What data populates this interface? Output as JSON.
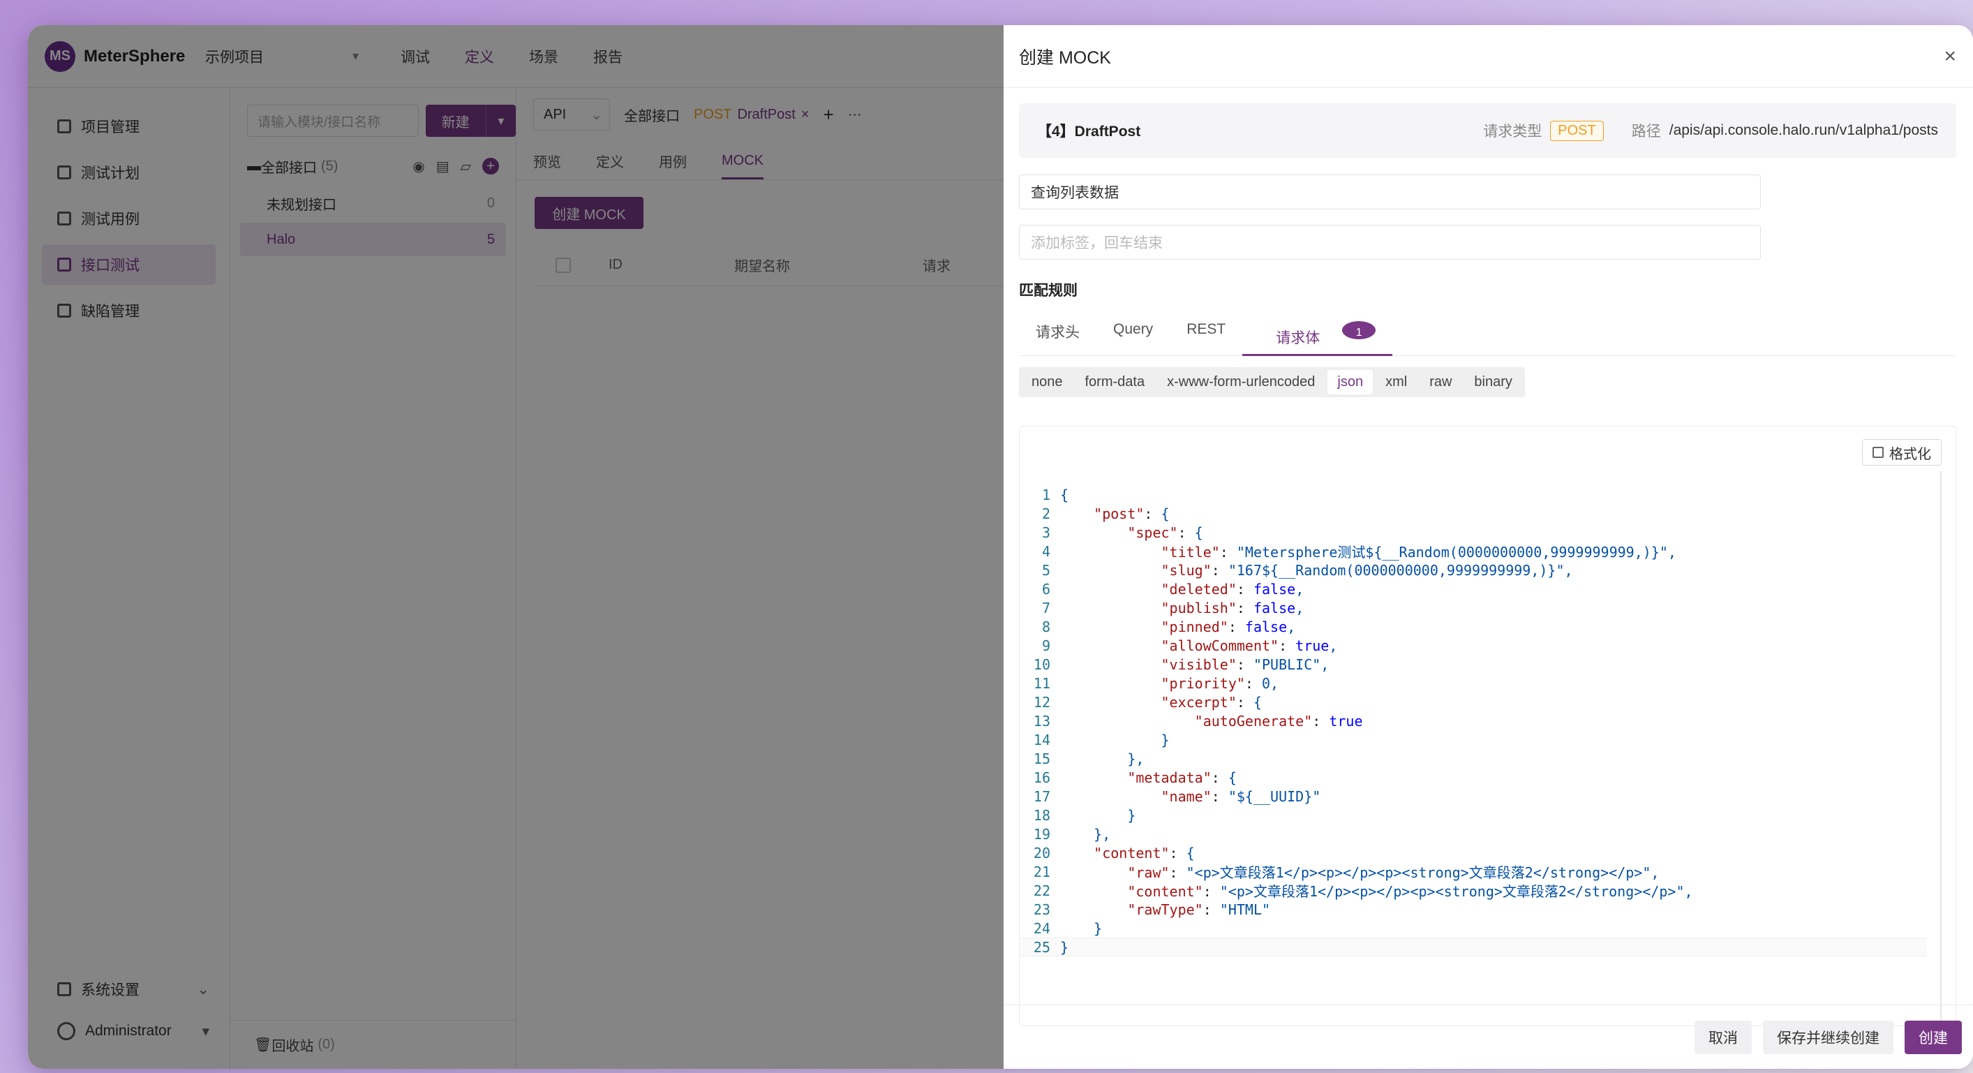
{
  "app": {
    "logo_text": "MeterSphere",
    "logo_glyph": "MS",
    "project": "示例项目",
    "top_nav": [
      "调试",
      "定义",
      "场景",
      "报告"
    ],
    "top_nav_active_index": 1
  },
  "sidebar": {
    "items": [
      {
        "label": "项目管理",
        "icon": "folder-icon"
      },
      {
        "label": "测试计划",
        "icon": "plan-icon"
      },
      {
        "label": "测试用例",
        "icon": "case-icon"
      },
      {
        "label": "接口测试",
        "icon": "api-icon"
      },
      {
        "label": "缺陷管理",
        "icon": "bug-icon"
      }
    ],
    "active_index": 3,
    "settings_label": "系统设置",
    "user_label": "Administrator"
  },
  "tree": {
    "search_placeholder": "请输入模块/接口名称",
    "new_button": "新建",
    "all_label": "全部接口",
    "all_count": "(5)",
    "nodes": [
      {
        "label": "未规划接口",
        "count": "0"
      },
      {
        "label": "Halo",
        "count": "5"
      }
    ],
    "recycle_label": "回收站",
    "recycle_count": "(0)"
  },
  "main": {
    "api_select": "API",
    "tab_all": "全部接口",
    "tab_active_method": "POST",
    "tab_active_name": "DraftPost",
    "plus": "+",
    "more": "···",
    "sub_tabs": [
      "预览",
      "定义",
      "用例",
      "MOCK"
    ],
    "sub_tab_active_index": 3,
    "create_mock_button": "创建 MOCK",
    "table_cols": [
      "ID",
      "期望名称",
      "请求"
    ]
  },
  "drawer": {
    "title": "创建 MOCK",
    "close": "×",
    "api_name": "【4】DraftPost",
    "request_type_label": "请求类型",
    "method": "POST",
    "path_label": "路径",
    "path": "/apis/api.console.halo.run/v1alpha1/posts",
    "expect_name": "查询列表数据",
    "tag_placeholder": "添加标签，回车结束",
    "match_rules_title": "匹配规则",
    "rule_tabs": [
      "请求头",
      "Query",
      "REST",
      "请求体"
    ],
    "rule_tab_active_index": 3,
    "rule_tab_badge": "1",
    "body_types": [
      "none",
      "form-data",
      "x-www-form-urlencoded",
      "json",
      "xml",
      "raw",
      "binary"
    ],
    "body_type_active_index": 3,
    "format_button": "格式化",
    "code_lines": [
      "{",
      "    \"post\": {",
      "        \"spec\": {",
      "            \"title\": \"Metersphere测试${__Random(0000000000,9999999999,)}\",",
      "            \"slug\": \"167${__Random(0000000000,9999999999,)}\",",
      "            \"deleted\": false,",
      "            \"publish\": false,",
      "            \"pinned\": false,",
      "            \"allowComment\": true,",
      "            \"visible\": \"PUBLIC\",",
      "            \"priority\": 0,",
      "            \"excerpt\": {",
      "                \"autoGenerate\": true",
      "            }",
      "        },",
      "        \"metadata\": {",
      "            \"name\": \"${__UUID}\"",
      "        }",
      "    },",
      "    \"content\": {",
      "        \"raw\": \"<p>文章段落1</p><p></p><p><strong>文章段落2</strong></p>\",",
      "        \"content\": \"<p>文章段落1</p><p></p><p><strong>文章段落2</strong></p>\",",
      "        \"rawType\": \"HTML\"",
      "    }",
      "}"
    ],
    "cancel_button": "取消",
    "save_continue_button": "保存并继续创建",
    "create_button": "创建"
  },
  "colors": {
    "accent": "#783887",
    "method_post": "#f0a020"
  }
}
